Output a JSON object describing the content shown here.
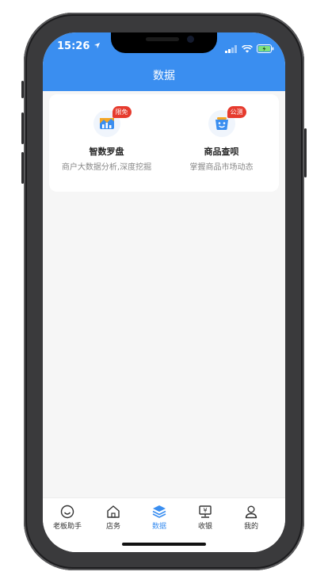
{
  "status": {
    "time": "15:26"
  },
  "header": {
    "title": "数据"
  },
  "features": [
    {
      "name": "智数罗盘",
      "desc": "商户大数据分析,深度挖掘",
      "badge": "限免",
      "icon": "chart-icon"
    },
    {
      "name": "商品查呗",
      "desc": "掌握商品市场动态",
      "badge": "公测",
      "icon": "basket-icon"
    }
  ],
  "tabs": [
    {
      "label": "老板助手",
      "icon": "smile-icon"
    },
    {
      "label": "店务",
      "icon": "home-icon"
    },
    {
      "label": "数据",
      "icon": "layers-icon",
      "active": true
    },
    {
      "label": "收银",
      "icon": "register-icon"
    },
    {
      "label": "我的",
      "icon": "user-icon"
    }
  ],
  "colors": {
    "accent": "#3a8ef0",
    "badge": "#e63b2e",
    "chart_orange": "#f5a623"
  }
}
